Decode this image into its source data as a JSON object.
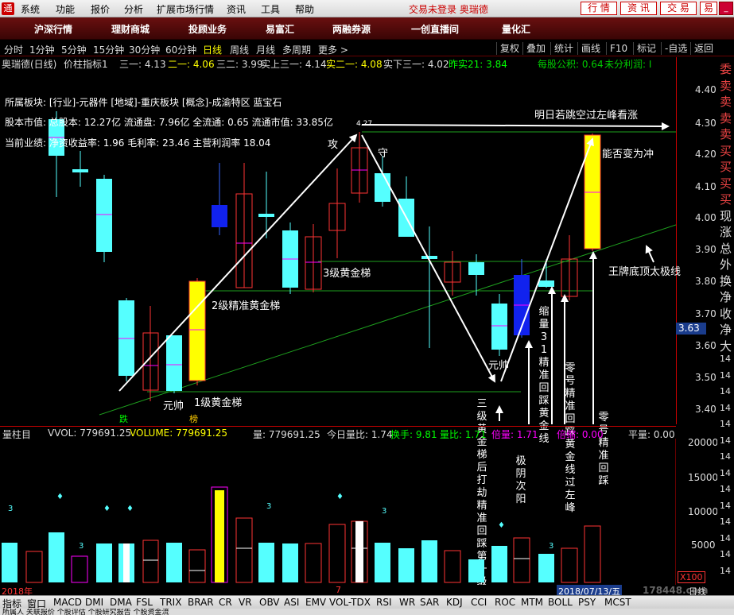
{
  "menubar": {
    "items": [
      "系统",
      "功能",
      "报价",
      "分析",
      "扩展市场行情",
      "资讯",
      "工具",
      "帮助"
    ],
    "status": "交易未登录  奥瑞德",
    "buttons": [
      "行 情",
      "资 讯",
      "交 易"
    ],
    "right_text": "易"
  },
  "navbar": {
    "items": [
      "沪深行情",
      "理财商城",
      "投顾业务",
      "易富汇",
      "两融券源",
      "一创直播间",
      "量化汇"
    ]
  },
  "periodbar": {
    "items": [
      "分时",
      "1分钟",
      "5分钟",
      "15分钟",
      "30分钟",
      "60分钟",
      "日线",
      "周线",
      "月线",
      "多周期",
      "更多 >"
    ],
    "active": "日线",
    "right_buttons": [
      "复权",
      "叠加",
      "统计",
      "画线",
      "F10",
      "标记",
      "-自选",
      "返回"
    ]
  },
  "infoline": {
    "title": "奥瑞德(日线)",
    "indicator": "价柱指标1",
    "t1": "三一: 4.13",
    "t2": "二一: 4.06",
    "t3": "三二: 3.99",
    "t4": "实上三一: 4.14",
    "t5": "实二一: 4.08",
    "t6": "实下三一: 4.02",
    "t7": "昨实21: 3.84",
    "t8": "每股公积: 0.64",
    "t9": "未分利润: I"
  },
  "info_block": {
    "sector": "所属板块: [行业]-元器件 [地域]-重庆板块 [概念]-成渝特区 蓝宝石",
    "capital": "股本市值: 总股本: 12.27亿 流通盘: 7.96亿 全流通: 0.65 流通市值: 33.85亿",
    "perf": "当前业绩: 净资收益率: 1.96 毛利率: 23.46 主营利润率 18.04"
  },
  "price_axis": {
    "ticks": [
      "4.40",
      "4.30",
      "4.20",
      "4.10",
      "4.00",
      "3.90",
      "3.80",
      "3.70",
      "3.60",
      "3.50",
      "3.40"
    ],
    "current_price": "3.63",
    "high_label": "4.27"
  },
  "annotations": {
    "top_note": "明日若跳空过左峰看涨",
    "attack": "攻",
    "defend": "守",
    "level3": "3级黄金梯",
    "level2": "2级精准黄金梯",
    "level1": "1级黄金梯",
    "yuanshuai1": "元帅",
    "yuanshuai2": "元帅",
    "change_to_rush": "能否变为冲",
    "king_line": "王牌底顶太极线",
    "v_sanji": "三级黄金梯后打劫精准回踩第一级黄金线",
    "v_jiyin": "极阴次阳",
    "v_suoliang": "缩量31精准回踩黄金线",
    "v_linghao1": "零号精准回踩黄金线过左峰",
    "v_linghao2": "零号精准回踩",
    "mark_die": "跌",
    "mark_bang": "榜"
  },
  "quote_strip": [
    "委",
    "卖",
    "卖",
    "卖",
    "卖",
    "买",
    "买",
    "买",
    "买",
    "现",
    "涨",
    "总",
    "外",
    "换",
    "净",
    "收",
    "净",
    "大",
    "14",
    "14",
    "14",
    "14",
    "14",
    "14",
    "14",
    "14",
    "14",
    "14",
    "14",
    "14",
    "14",
    "14"
  ],
  "volheader": {
    "name": "量柱目",
    "vvol": "VVOL: 779691.25",
    "volume": "VOLUME: 779691.25",
    "liang": "量: 779691.25",
    "ratio": "今日量比: 1.74",
    "turnover": "换手: 9.81",
    "liangbi": "量比: 1.71",
    "ratio2": "倍量: 1.71",
    "beiliang": "倍缩: 0.00",
    "pingliang": "平量: 0.00"
  },
  "vol_axis": {
    "ticks": [
      "20000",
      "15000",
      "10000",
      "5000"
    ],
    "scale": "X100"
  },
  "datebar": {
    "year": "2018年",
    "month": "7",
    "cursor_date": "2018/07/13/五",
    "right": "日线"
  },
  "indicators": [
    "指标",
    "窗口",
    "MACD",
    "DMI",
    "DMA",
    "FSL",
    "TRIX",
    "BRAR",
    "CR",
    "VR",
    "OBV",
    "ASI",
    "EMV",
    "VOL-TDX",
    "RSI",
    "WR",
    "SAR",
    "KDJ",
    "CCI",
    "ROC",
    "MTM",
    "BOLL",
    "PSY",
    "MCST"
  ],
  "watermark": "178448.com",
  "statusbar": "所属人  关联报价  个股评估  个股研究报告  个股资金流"
}
